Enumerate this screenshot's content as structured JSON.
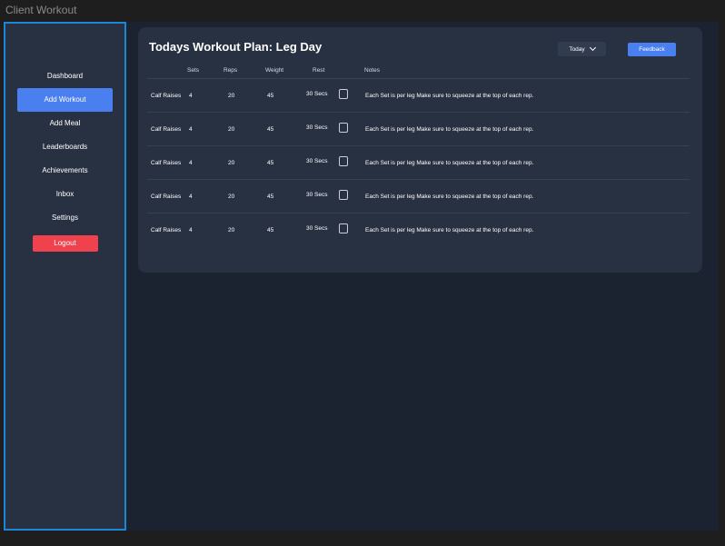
{
  "window": {
    "title": "Client Workout"
  },
  "sidebar": {
    "items": [
      {
        "label": "Dashboard",
        "active": false
      },
      {
        "label": "Add Workout",
        "active": true
      },
      {
        "label": "Add Meal",
        "active": false
      },
      {
        "label": "Leaderboards",
        "active": false
      },
      {
        "label": "Achievements",
        "active": false
      },
      {
        "label": "Inbox",
        "active": false
      },
      {
        "label": "Settings",
        "active": false
      }
    ],
    "logout_label": "Logout"
  },
  "plan": {
    "title": "Todays Workout Plan: Leg Day",
    "date_select": {
      "value": "Today"
    },
    "feedback_label": "Feedback",
    "columns": {
      "exercise": "",
      "sets": "Sets",
      "reps": "Reps",
      "weight": "Weight",
      "rest": "Rest",
      "done": "",
      "notes": "Notes"
    },
    "rows": [
      {
        "exercise": "Calf Raises",
        "sets": "4",
        "reps": "20",
        "weight": "45",
        "rest": "30 Secs",
        "done": false,
        "notes": "Each Set is per leg Make sure to squeeze at the top of each rep."
      },
      {
        "exercise": "Calf Raises",
        "sets": "4",
        "reps": "20",
        "weight": "45",
        "rest": "30 Secs",
        "done": false,
        "notes": "Each Set is per leg Make sure to squeeze at the top of each rep."
      },
      {
        "exercise": "Calf Raises",
        "sets": "4",
        "reps": "20",
        "weight": "45",
        "rest": "30 Secs",
        "done": false,
        "notes": "Each Set is per leg Make sure to squeeze at the top of each rep."
      },
      {
        "exercise": "Calf Raises",
        "sets": "4",
        "reps": "20",
        "weight": "45",
        "rest": "30 Secs",
        "done": false,
        "notes": "Each Set is per leg Make sure to squeeze at the top of each rep."
      },
      {
        "exercise": "Calf Raises",
        "sets": "4",
        "reps": "20",
        "weight": "45",
        "rest": "30 Secs",
        "done": false,
        "notes": "Each Set is per leg Make sure to squeeze at the top of each rep."
      }
    ]
  },
  "colors": {
    "accent": "#4a7ff0",
    "danger": "#f0424e",
    "sidebar_border": "#1e86d6"
  }
}
